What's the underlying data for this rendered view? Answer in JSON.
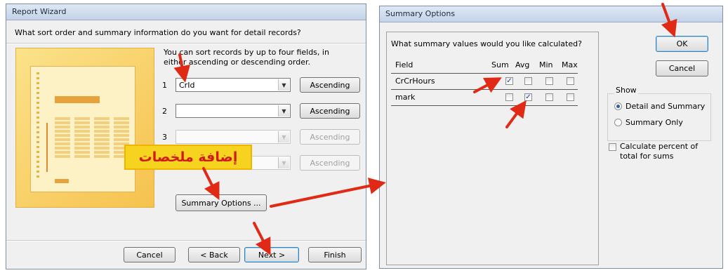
{
  "wizard": {
    "title": "Report Wizard",
    "question": "What sort order and summary information do you want for detail records?",
    "hint": "You can sort records by up to four fields, in either ascending or descending order.",
    "sort_rows": [
      {
        "index": "1",
        "field": "CrId",
        "order": "Ascending"
      },
      {
        "index": "2",
        "field": "",
        "order": "Ascending"
      },
      {
        "index": "3",
        "field": "",
        "order": "Ascending"
      },
      {
        "index": "4",
        "field": "",
        "order": "Ascending"
      }
    ],
    "summary_button": "Summary Options ...",
    "annotation": "إضافة ملخصات",
    "buttons": {
      "cancel": "Cancel",
      "back": "< Back",
      "next": "Next >",
      "finish": "Finish"
    }
  },
  "summary": {
    "title": "Summary Options",
    "question": "What summary values would you like calculated?",
    "columns": {
      "field": "Field",
      "sum": "Sum",
      "avg": "Avg",
      "min": "Min",
      "max": "Max"
    },
    "rows": [
      {
        "field": "CrCrHours",
        "sum": true,
        "avg": false,
        "min": false,
        "max": false
      },
      {
        "field": "mark",
        "sum": false,
        "avg": true,
        "min": false,
        "max": false
      }
    ],
    "ok": "OK",
    "cancel": "Cancel",
    "show_label": "Show",
    "show_options": [
      "Detail and Summary",
      "Summary Only"
    ],
    "show_selected": 0,
    "percent_label": "Calculate percent of total for sums",
    "percent_checked": false
  },
  "colors": {
    "annotation_arrow": "#e02a16",
    "annotation_text": "#d11a1a",
    "annotation_bg": "#f6d31e"
  }
}
